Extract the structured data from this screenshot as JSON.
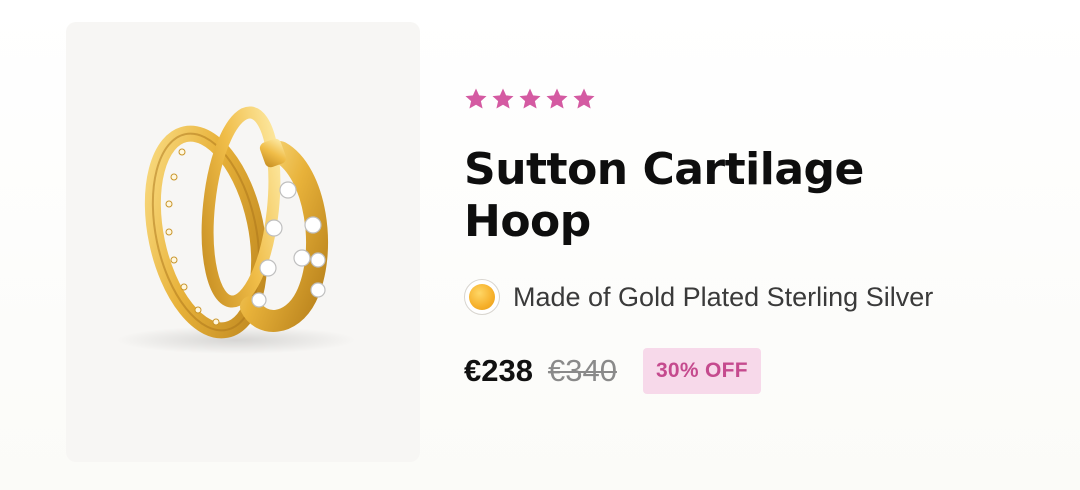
{
  "product": {
    "rating_stars": 5,
    "star_color": "#d45aa2",
    "title": "Sutton Cartilage Hoop",
    "material": {
      "swatch_color": "#f6b02b",
      "label": "Made of Gold Plated Sterling Silver"
    },
    "price": {
      "current": "€238",
      "original": "€340",
      "discount": "30% OFF"
    }
  }
}
